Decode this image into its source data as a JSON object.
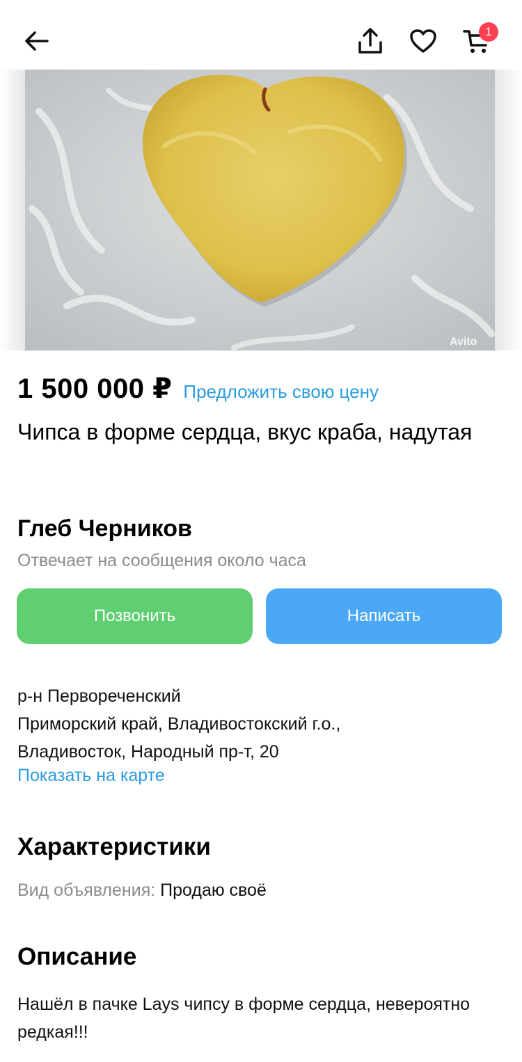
{
  "header": {
    "badge_count": "1"
  },
  "photo": {
    "watermark": "Avito"
  },
  "listing": {
    "price": "1 500 000 ₽",
    "offer_link": "Предложить свою цену",
    "title": "Чипса в форме сердца, вкус краба, надутая"
  },
  "seller": {
    "name": "Глеб Черников",
    "response_time": "Отвечает на сообщения около часа"
  },
  "actions": {
    "call_label": "Позвонить",
    "write_label": "Написать"
  },
  "location": {
    "district": "р-н Первореченский",
    "region": "Приморский край, Владивостокский г.о.,",
    "street": "Владивосток, Народный пр-т, 20",
    "map_link": "Показать на карте"
  },
  "specs": {
    "heading": "Характеристики",
    "items": [
      {
        "key": "Вид объявления: ",
        "value": "Продаю своё"
      }
    ]
  },
  "description": {
    "heading": "Описание",
    "text": "Нашёл в пачке Lays чипсу в форме сердца, невероятно редкая!!!"
  },
  "colors": {
    "call_button": "#5fcf71",
    "write_button": "#4aa8f5",
    "link": "#2b9cdf",
    "badge": "#ff4053"
  }
}
